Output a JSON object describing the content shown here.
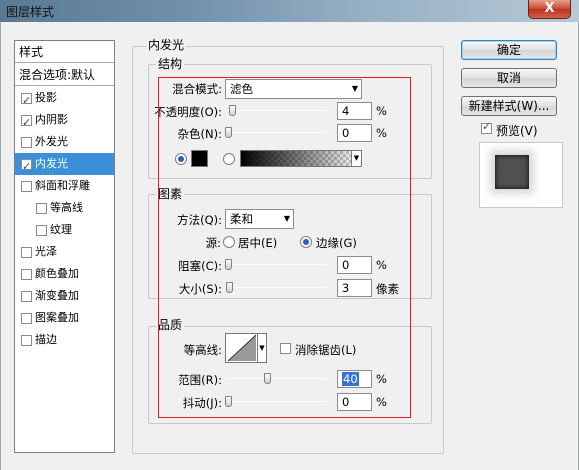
{
  "window": {
    "title": "图层样式",
    "close_label": "X"
  },
  "sidebar": {
    "header": "样式",
    "blend_options": "混合选项:默认",
    "items": [
      {
        "label": "投影",
        "checked": true,
        "selected": false
      },
      {
        "label": "内阴影",
        "checked": true,
        "selected": false
      },
      {
        "label": "外发光",
        "checked": false,
        "selected": false
      },
      {
        "label": "内发光",
        "checked": true,
        "selected": true
      },
      {
        "label": "斜面和浮雕",
        "checked": false,
        "selected": false
      },
      {
        "label": "等高线",
        "checked": false,
        "selected": false,
        "indent": true
      },
      {
        "label": "纹理",
        "checked": false,
        "selected": false,
        "indent": true
      },
      {
        "label": "光泽",
        "checked": false,
        "selected": false
      },
      {
        "label": "颜色叠加",
        "checked": false,
        "selected": false
      },
      {
        "label": "渐变叠加",
        "checked": false,
        "selected": false
      },
      {
        "label": "图案叠加",
        "checked": false,
        "selected": false
      },
      {
        "label": "描边",
        "checked": false,
        "selected": false
      }
    ]
  },
  "panel": {
    "title": "内发光",
    "structure": {
      "title": "结构",
      "blend_mode_label": "混合模式:",
      "blend_mode_value": "滤色",
      "opacity_label": "不透明度(O):",
      "opacity_value": "4",
      "opacity_level": 4,
      "noise_label": "杂色(N):",
      "noise_value": "0",
      "noise_level": 0,
      "unit": "%",
      "glow_color": "#000000",
      "color_mode": "solid"
    },
    "elements": {
      "title": "图素",
      "method_label": "方法(Q):",
      "method_value": "柔和",
      "source_label": "源:",
      "source_center": "居中(E)",
      "source_edge": "边缘(G)",
      "source_selected": "edge",
      "choke_label": "阻塞(C):",
      "choke_value": "0",
      "choke_level": 0,
      "size_label": "大小(S):",
      "size_value": "3",
      "size_unit": "像素",
      "size_level": 1.2,
      "unit": "%"
    },
    "quality": {
      "title": "品质",
      "contour_label": "等高线:",
      "antialias_label": "消除锯齿(L)",
      "antialias_checked": false,
      "range_label": "范围(R):",
      "range_value": "40",
      "range_level": 40,
      "jitter_label": "抖动(J):",
      "jitter_value": "0",
      "jitter_level": 0,
      "unit": "%"
    }
  },
  "buttons": {
    "ok": "确定",
    "cancel": "取消",
    "new_style": "新建样式(W)...",
    "preview_label": "预览(V)",
    "preview_checked": true
  },
  "colors": {
    "selection": "#3b8fd8",
    "annotation_box": "#e02020",
    "preview_swatch": "#505050"
  }
}
